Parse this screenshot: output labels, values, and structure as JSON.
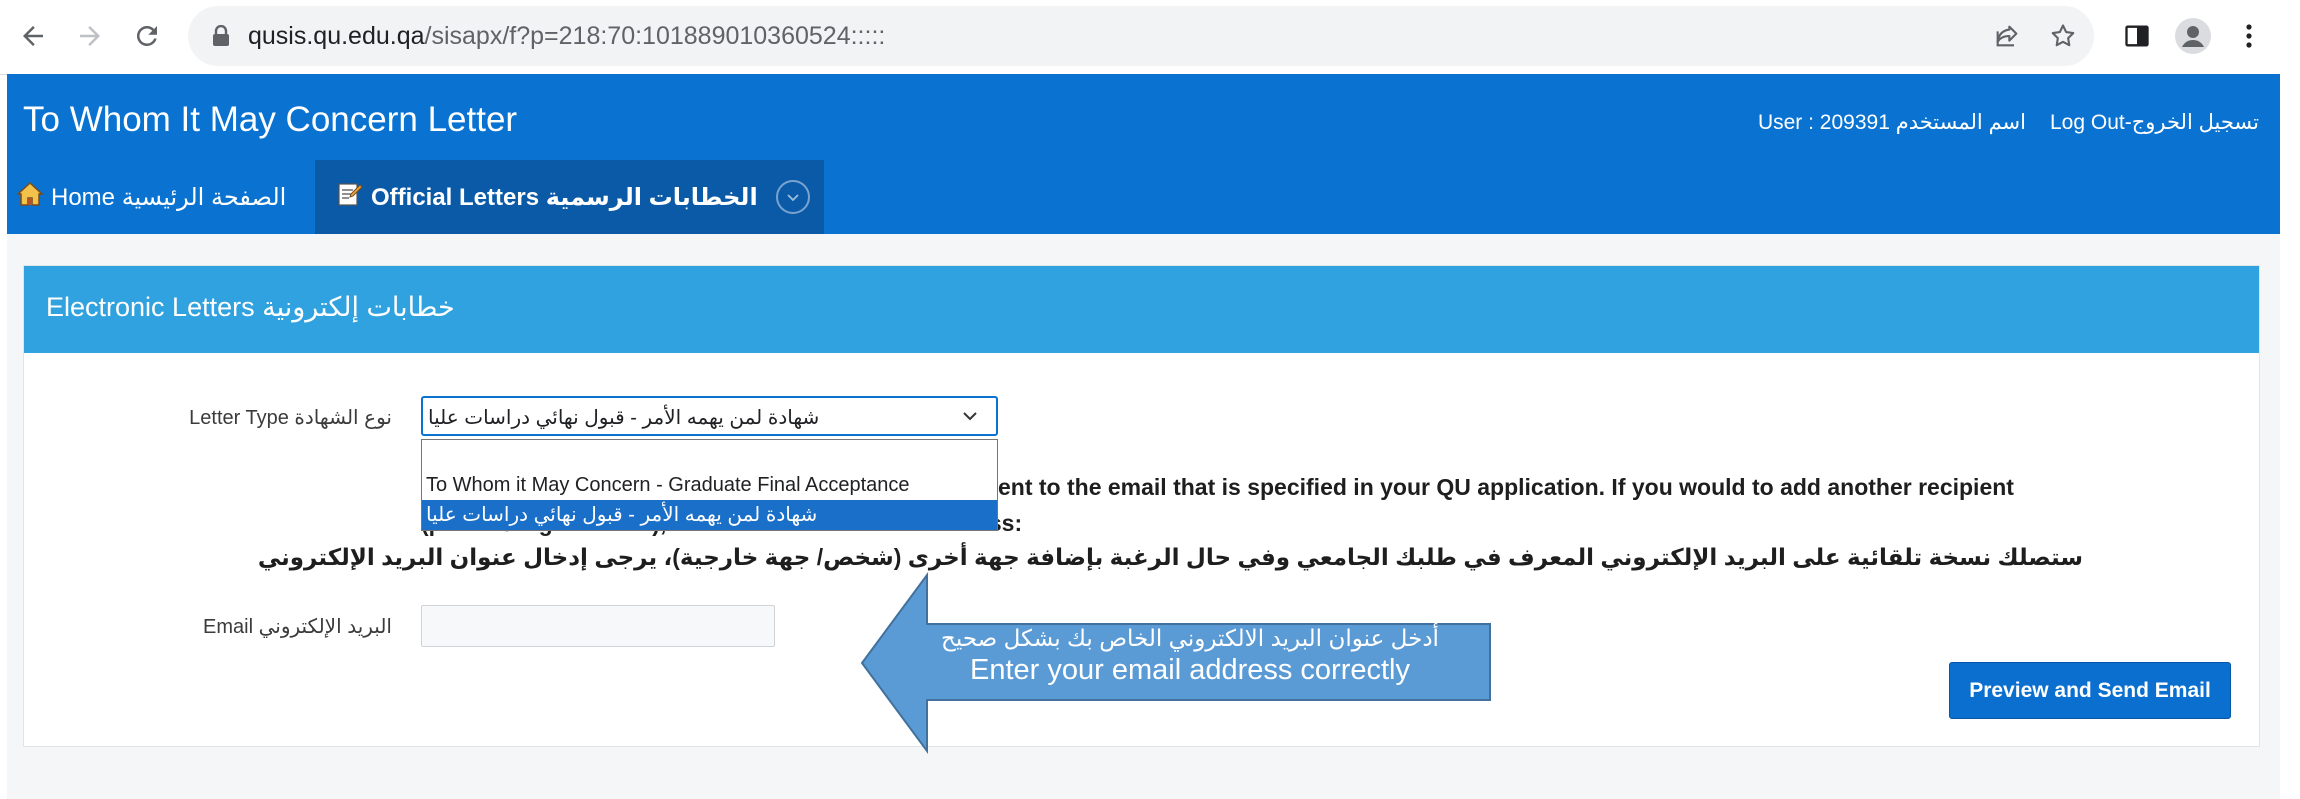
{
  "browser": {
    "url_host": "qusis.qu.edu.qa",
    "url_path": "/sisapx/f?p=218:70:101889010360524:::::"
  },
  "header": {
    "title": "To Whom It May Concern Letter",
    "user_label": "User : 209391 اسم المستخدم",
    "logout_label": "Log Out-تسجيل الخروج"
  },
  "nav": {
    "home_label": "Home الصفحة الرئيسية",
    "letters_label": "Official Letters الخطابات الرسمية"
  },
  "panel": {
    "title": "Electronic Letters خطابات إلكترونية",
    "letter_type_label": "Letter Type نوع الشهادة",
    "letter_type_value": "شهادة لمن يهمه الأمر - قبول نهائي دراسات عليا",
    "dropdown_options": [
      "",
      "To Whom it May Concern - Graduate Final Acceptance",
      "شهادة لمن يهمه الأمر - قبول نهائي دراسات عليا"
    ],
    "notice_en_line1": "ent to the email that is specified in your QU application. If you would to add another recipient",
    "notice_en_line2": "(person/Organization), Please enter the Email Address:",
    "notice_ar": "ستصلك نسخة تلقائية على البريد الإلكتروني المعرف في طلبك الجامعي وفي حال الرغبة بإضافة جهة أخرى (شخص/ جهة خارجية)، يرجى إدخال عنوان البريد الإلكتروني",
    "email_label": "Email البريد الإلكتروني",
    "email_value": "",
    "preview_button": "Preview and Send Email"
  },
  "callout": {
    "text_ar": "أدخل عنوان البريد الالكتروني الخاص بك بشكل صحيح",
    "text_en": "Enter your email address correctly",
    "fill": "#5b9bd5",
    "stroke": "#41719c"
  },
  "colors": {
    "header_blue": "#0a73d1",
    "nav_active": "#0b5aa8",
    "panel_header": "#31a2e0",
    "button": "#0a6fcf"
  }
}
